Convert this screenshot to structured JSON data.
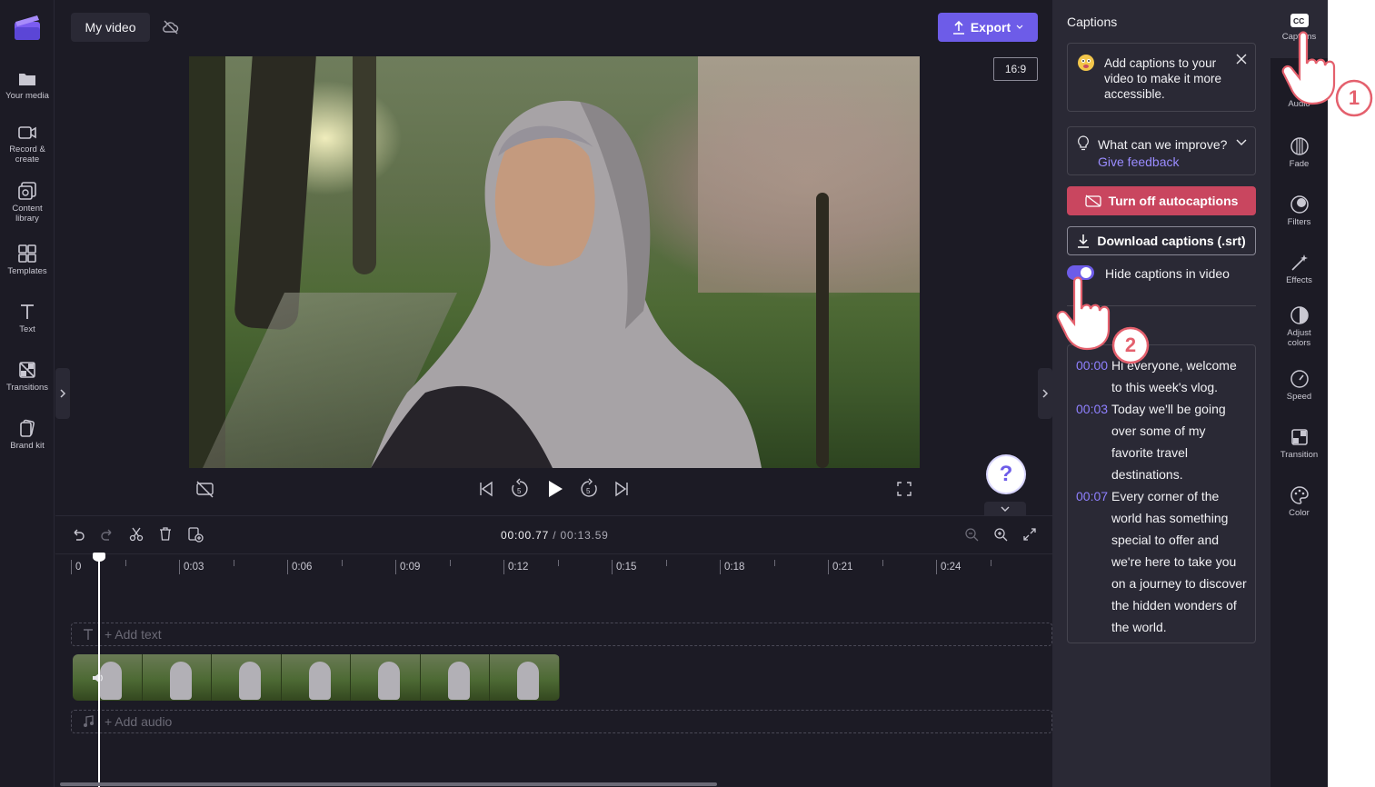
{
  "app": {
    "project_title": "My video",
    "export_label": "Export",
    "aspect_ratio": "16:9",
    "accent_color": "#6d5ce8"
  },
  "left_nav": [
    {
      "label": "Your media",
      "icon": "folder-icon"
    },
    {
      "label": "Record &\ncreate",
      "icon": "camera-icon"
    },
    {
      "label": "Content\nlibrary",
      "icon": "library-icon"
    },
    {
      "label": "Templates",
      "icon": "templates-icon"
    },
    {
      "label": "Text",
      "icon": "text-icon"
    },
    {
      "label": "Transitions",
      "icon": "transitions-icon"
    },
    {
      "label": "Brand kit",
      "icon": "brand-kit-icon"
    }
  ],
  "player": {
    "current_time": "00:00.77",
    "total_time": "/ 00:13.59",
    "help_label": "?"
  },
  "timeline": {
    "ticks": [
      "0",
      "0:03",
      "0:06",
      "0:09",
      "0:12",
      "0:15",
      "0:18",
      "0:21",
      "0:24"
    ],
    "add_text": "+ Add text",
    "add_audio": "+ Add audio"
  },
  "captions_panel": {
    "title": "Captions",
    "tip": "Add captions to your video to make it more accessible.",
    "feedback_question": "What can we improve?",
    "feedback_link": "Give feedback",
    "turn_off_label": "Turn off autocaptions",
    "download_label": "Download captions (.srt)",
    "hide_toggle_label": "Hide captions in video",
    "hide_toggle_on": true,
    "transcript": [
      {
        "time": "00:00",
        "text": "Hi everyone, welcome to this week's vlog."
      },
      {
        "time": "00:03",
        "text": "Today we'll be going over some of my favorite travel destinations."
      },
      {
        "time": "00:07",
        "text": "Every corner of the world has something special to offer and we're here to take you on a journey to discover the hidden wonders of the world."
      }
    ],
    "turn_off_color": "#c9465f"
  },
  "right_rail": [
    {
      "label": "Captions",
      "icon": "cc-icon"
    },
    {
      "label": "Audio",
      "icon": "audio-icon"
    },
    {
      "label": "Fade",
      "icon": "fade-icon"
    },
    {
      "label": "Filters",
      "icon": "filters-icon"
    },
    {
      "label": "Effects",
      "icon": "effects-icon"
    },
    {
      "label": "Adjust\ncolors",
      "icon": "adjust-colors-icon"
    },
    {
      "label": "Speed",
      "icon": "speed-icon"
    },
    {
      "label": "Transition",
      "icon": "transition-icon"
    },
    {
      "label": "Color",
      "icon": "color-palette-icon"
    }
  ],
  "tutorial": {
    "step1": "1",
    "step2": "2"
  }
}
